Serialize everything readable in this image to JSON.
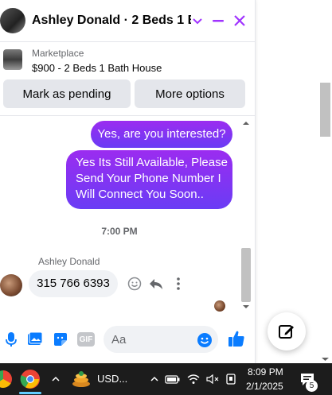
{
  "chat": {
    "title": "Ashley Donald · 2 Beds 1 B...",
    "listing": {
      "label": "Marketplace",
      "title": "$900 - 2 Beds 1 Bath House"
    },
    "actions": {
      "mark_pending": "Mark as pending",
      "more_options": "More options"
    },
    "messages": {
      "out1": "Yes, are you interested?",
      "out2_line1": "Yes Its Still Available, Please",
      "out2_line2": "Send Your Phone Number I",
      "out2_line3": "Will Connect You Soon..",
      "time": "7:00 PM",
      "sender": "Ashley Donald",
      "in1": "315 766 6393"
    },
    "composer": {
      "placeholder": "Aa",
      "gif_label": "GIF"
    }
  },
  "taskbar": {
    "app_label": "USD...",
    "time": "8:09 PM",
    "date": "2/1/2025",
    "notification_count": "5"
  },
  "colors": {
    "accent": "#a033ff",
    "bubble_gradient_top": "#9b2cf0",
    "bubble_gradient_bottom": "#6a3cf5",
    "icon_blue": "#0a7cff"
  }
}
